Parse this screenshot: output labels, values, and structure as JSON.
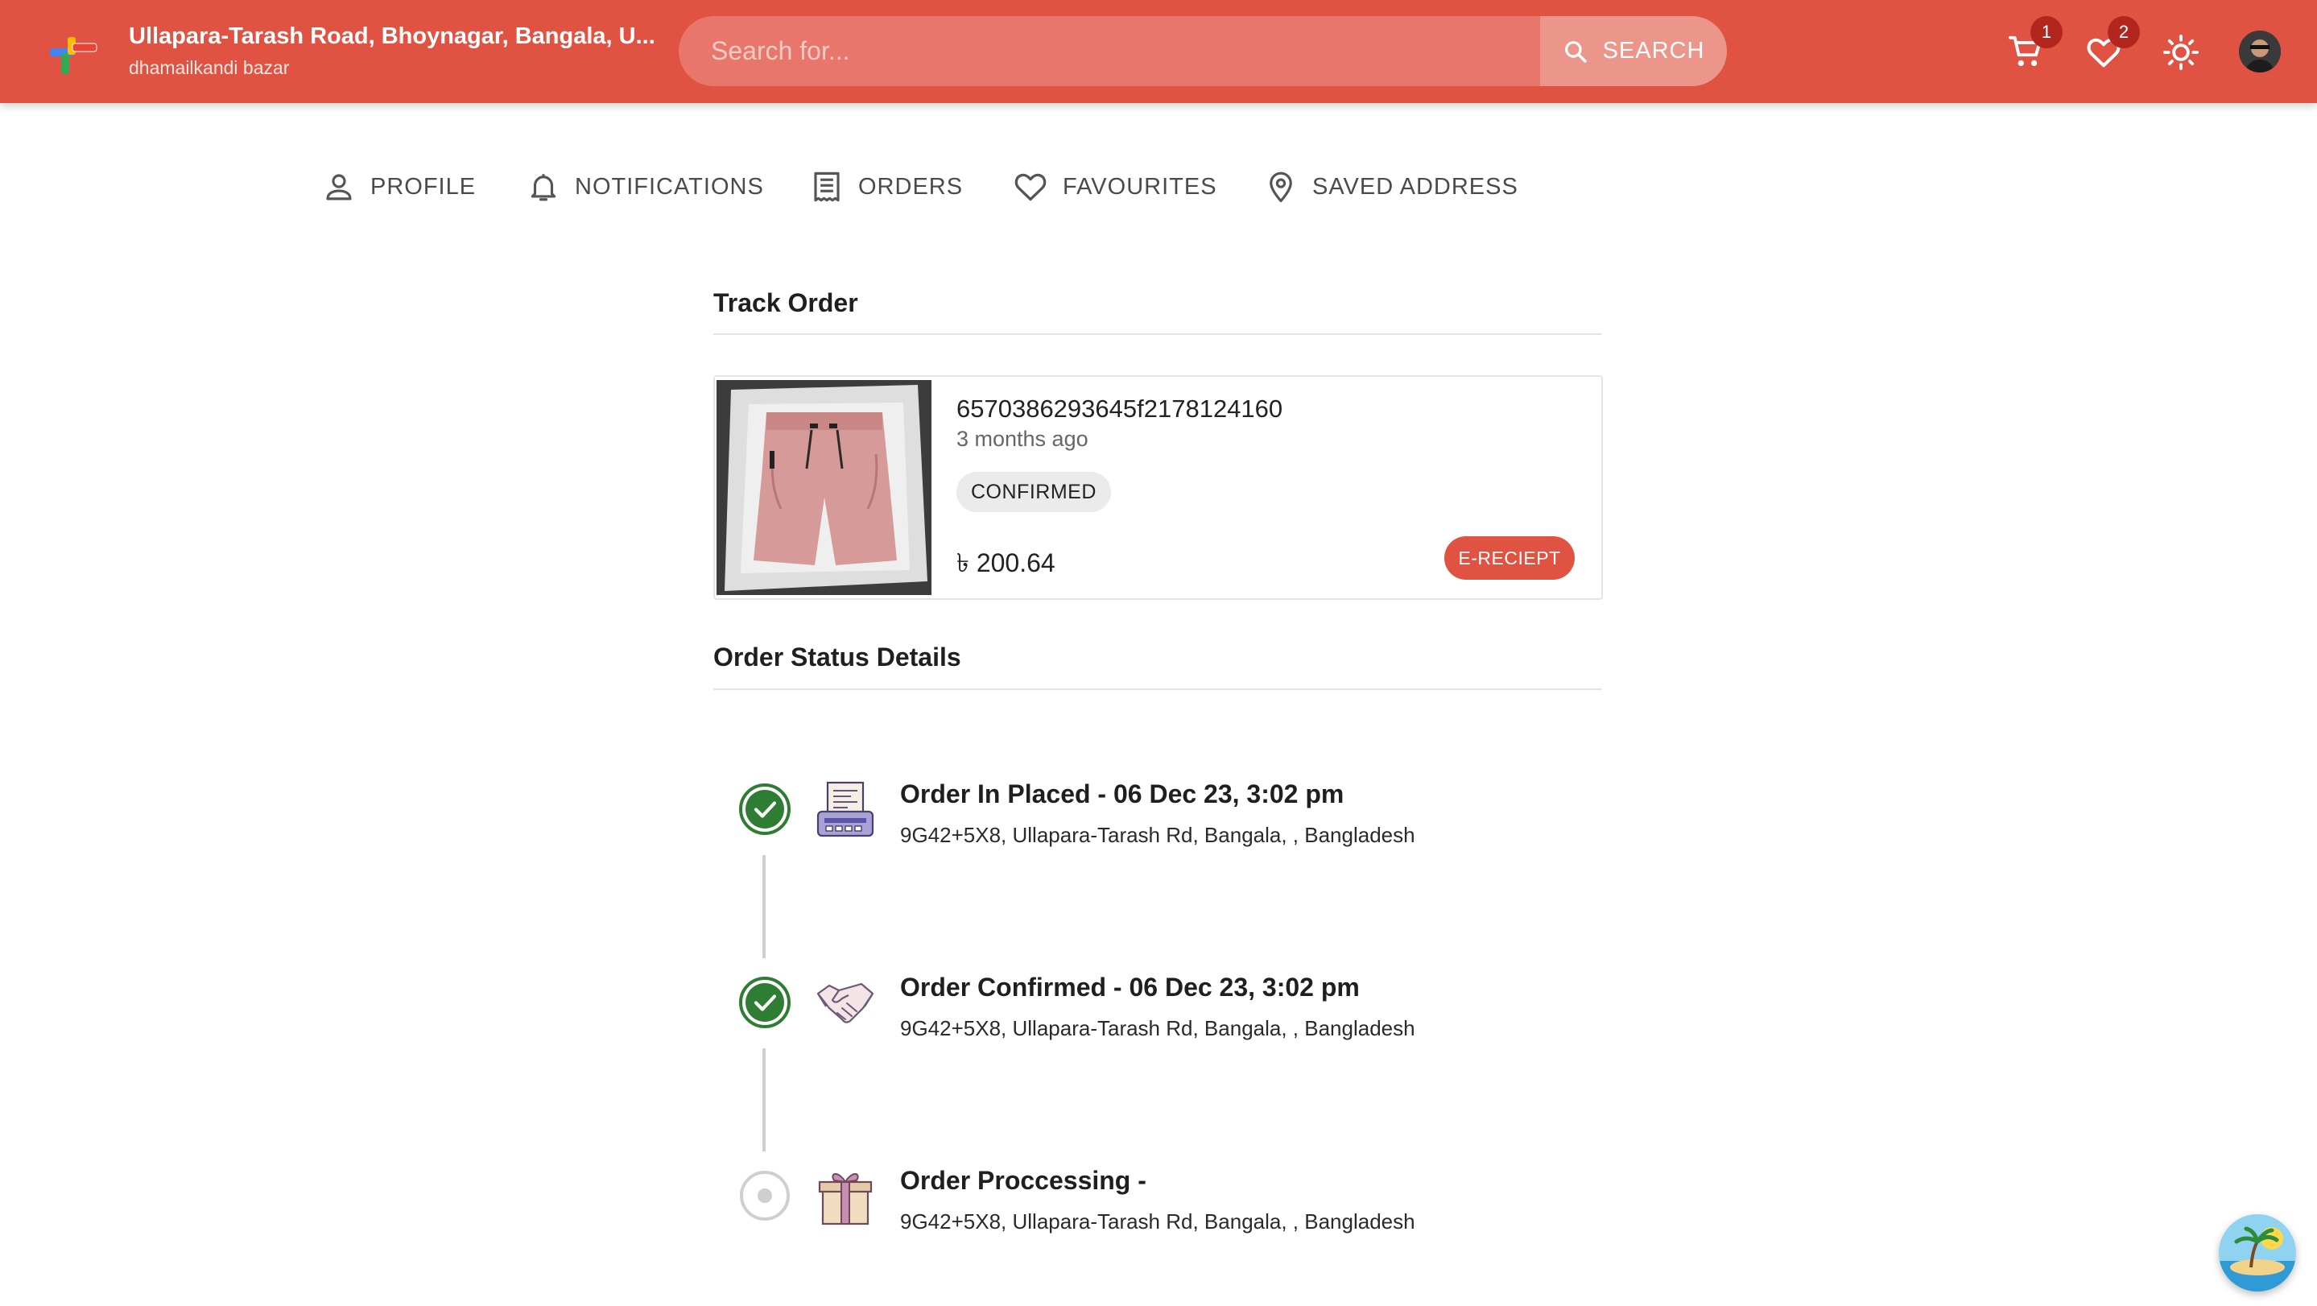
{
  "header": {
    "location_title": "Ullapara-Tarash Road, Bhoynagar, Bangala, U...",
    "location_subtitle": "dhamailkandi bazar",
    "search": {
      "placeholder": "Search for...",
      "value": "",
      "button_label": "SEARCH"
    },
    "cart_count": "1",
    "favourites_count": "2",
    "theme_icon": "sun-icon",
    "accent_color": "#e05343"
  },
  "nav": {
    "tabs": [
      {
        "label": "PROFILE",
        "icon": "person-icon"
      },
      {
        "label": "NOTIFICATIONS",
        "icon": "bell-icon"
      },
      {
        "label": "ORDERS",
        "icon": "receipt-list-icon"
      },
      {
        "label": "FAVOURITES",
        "icon": "heart-icon"
      },
      {
        "label": "SAVED ADDRESS",
        "icon": "location-pin-icon"
      }
    ]
  },
  "track_order": {
    "title": "Track Order",
    "order": {
      "id": "6570386293645f2178124160",
      "time_ago": "3 months ago",
      "status": "CONFIRMED",
      "price": "৳ 200.64",
      "ereceipt_label": "E-RECIEPT"
    }
  },
  "status_details": {
    "title": "Order Status Details",
    "steps": [
      {
        "title": "Order In Placed - 06 Dec 23, 3:02 pm",
        "address": "9G42+5X8, Ullapara-Tarash Rd, Bangala, , Bangladesh",
        "done": true,
        "icon": "receipt-printer-icon"
      },
      {
        "title": "Order Confirmed - 06 Dec 23, 3:02 pm",
        "address": "9G42+5X8, Ullapara-Tarash Rd, Bangala, , Bangladesh",
        "done": true,
        "icon": "handshake-icon"
      },
      {
        "title": "Order Proccessing -",
        "address": "9G42+5X8, Ullapara-Tarash Rd, Bangala, , Bangladesh",
        "done": false,
        "icon": "gift-box-icon"
      }
    ],
    "done_color": "#2e7d32"
  }
}
